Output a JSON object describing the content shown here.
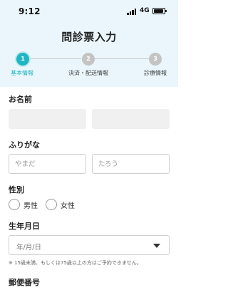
{
  "status_bar": {
    "time": "9:12",
    "network": "4G"
  },
  "header": {
    "title": "問診票入力"
  },
  "steps": [
    {
      "number": "1",
      "label": "基本情報",
      "active": true
    },
    {
      "number": "2",
      "label": "決済・配送情報",
      "active": false
    },
    {
      "number": "3",
      "label": "診療情報",
      "active": false
    }
  ],
  "colors": {
    "accent": "#20b5c2",
    "header_bg": "#eaf6fb",
    "inactive_step": "#c4c4c4"
  },
  "form": {
    "name_label": "お名前",
    "furigana_label": "ふりがな",
    "furigana_last_placeholder": "やまだ",
    "furigana_first_placeholder": "たろう",
    "gender_label": "性別",
    "gender_options": [
      "男性",
      "女性"
    ],
    "birthdate_label": "生年月日",
    "birthdate_placeholder": "年/月/日",
    "birthdate_note": "※ 15歳未満、もしくは75歳以上の方はご予約できません。",
    "postal_label": "郵便番号"
  }
}
